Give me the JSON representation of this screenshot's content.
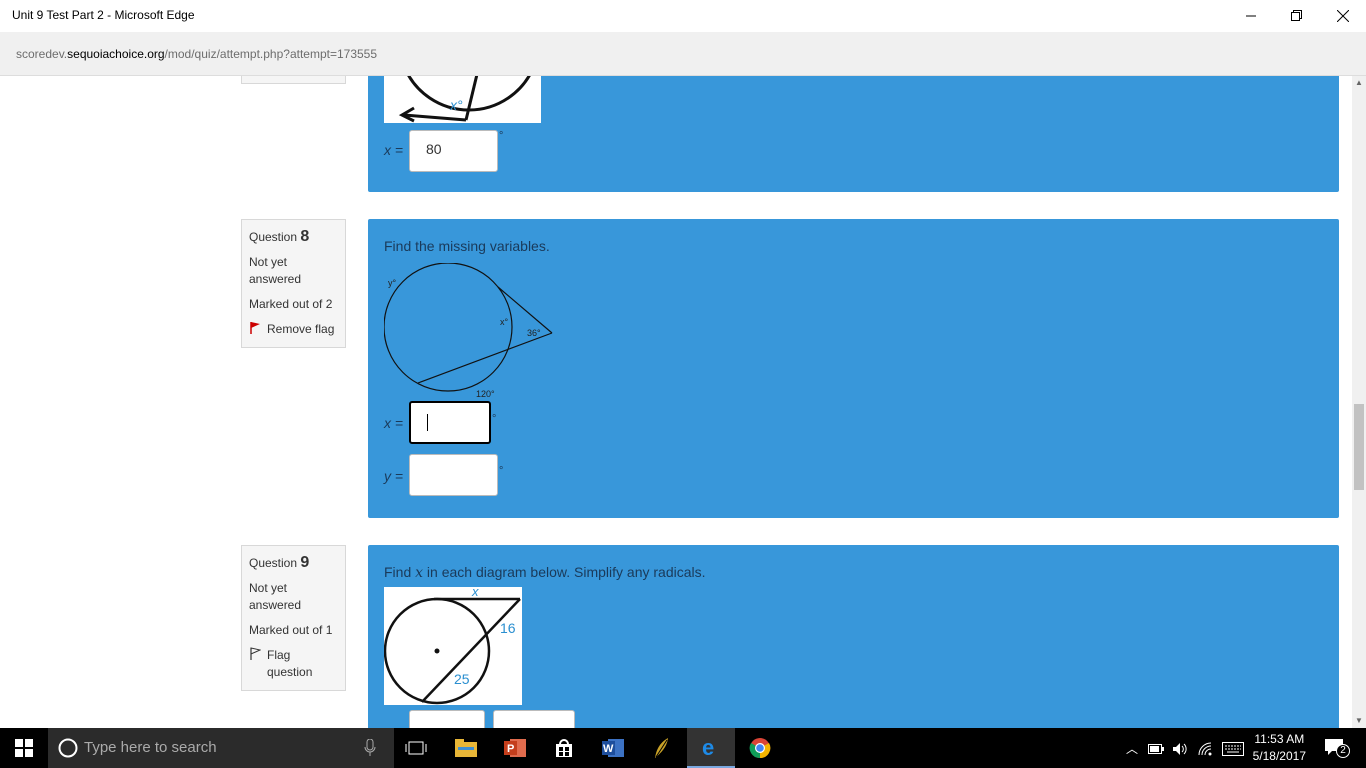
{
  "window": {
    "title": "Unit 9 Test Part 2 - Microsoft Edge"
  },
  "address": {
    "prefix": "scoredev.",
    "domain": "sequoiachoice.org",
    "path": "/mod/quiz/attempt.php?attempt=173555"
  },
  "q7": {
    "answer_label": "x =",
    "answer_value": "80",
    "degree": "°",
    "figure_label": "x°"
  },
  "q8": {
    "number_label": "Question",
    "number": "8",
    "status": "Not yet answered",
    "marks": "Marked out of 2",
    "flag_label": "Remove flag",
    "text": "Find the missing variables.",
    "fig_labels": {
      "y": "y°",
      "x": "x°",
      "angle": "36°",
      "arc": "120°"
    },
    "x_label": "x =",
    "y_label": "y =",
    "degree": "°",
    "x_value": "",
    "y_value": ""
  },
  "q9": {
    "number_label": "Question",
    "number": "9",
    "status": "Not yet answered",
    "marks": "Marked out of 1",
    "flag_label": "Flag question",
    "text_pre": "Find ",
    "text_var": "x",
    "text_post": " in each diagram below. Simplify any radicals.",
    "fig_labels": {
      "x": "x",
      "a": "16",
      "b": "25"
    }
  },
  "taskbar": {
    "search_placeholder": "Type here to search",
    "time": "11:53 AM",
    "date": "5/18/2017",
    "notifications": "2"
  },
  "colors": {
    "panel": "#3897da",
    "taskbar": "#000000"
  }
}
